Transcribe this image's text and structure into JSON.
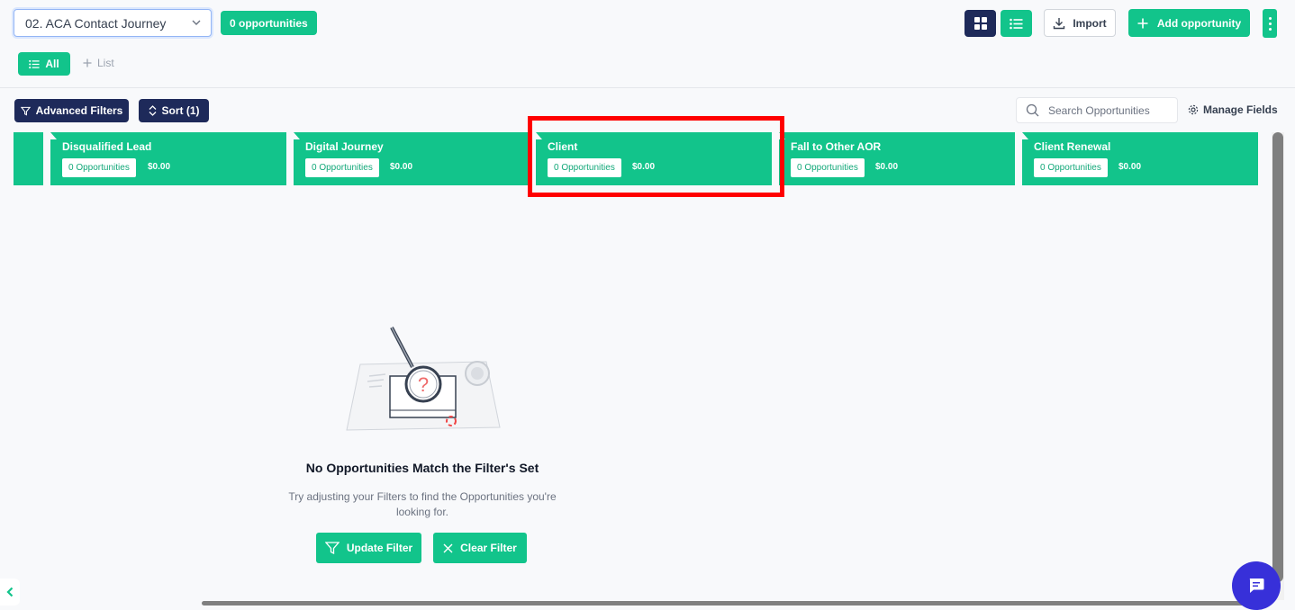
{
  "header": {
    "pipeline_select": "02. ACA Contact Journey",
    "opportunity_count": "0 opportunities",
    "import_label": "Import",
    "add_opportunity_label": "Add opportunity"
  },
  "tabs": {
    "all_label": "All",
    "add_list_label": "List"
  },
  "toolbar": {
    "advanced_filters_label": "Advanced Filters",
    "sort_label": "Sort (1)",
    "search_placeholder": "Search Opportunities",
    "manage_fields_label": "Manage Fields"
  },
  "stages": [
    {
      "name": "Disqualified Lead",
      "count": "0 Opportunities",
      "value": "$0.00"
    },
    {
      "name": "Digital Journey",
      "count": "0 Opportunities",
      "value": "$0.00"
    },
    {
      "name": "Client",
      "count": "0 Opportunities",
      "value": "$0.00"
    },
    {
      "name": "Fall to Other AOR",
      "count": "0 Opportunities",
      "value": "$0.00"
    },
    {
      "name": "Client Renewal",
      "count": "0 Opportunities",
      "value": "$0.00"
    }
  ],
  "empty_state": {
    "title": "No Opportunities Match the Filter's Set",
    "description": "Try adjusting your Filters to find the Opportunities you're looking for.",
    "update_filter_label": "Update Filter",
    "clear_filter_label": "Clear Filter"
  },
  "colors": {
    "accent": "#12c48b",
    "navy": "#1e2a5a",
    "highlight": "#ff0000",
    "chat": "#3730d9"
  }
}
